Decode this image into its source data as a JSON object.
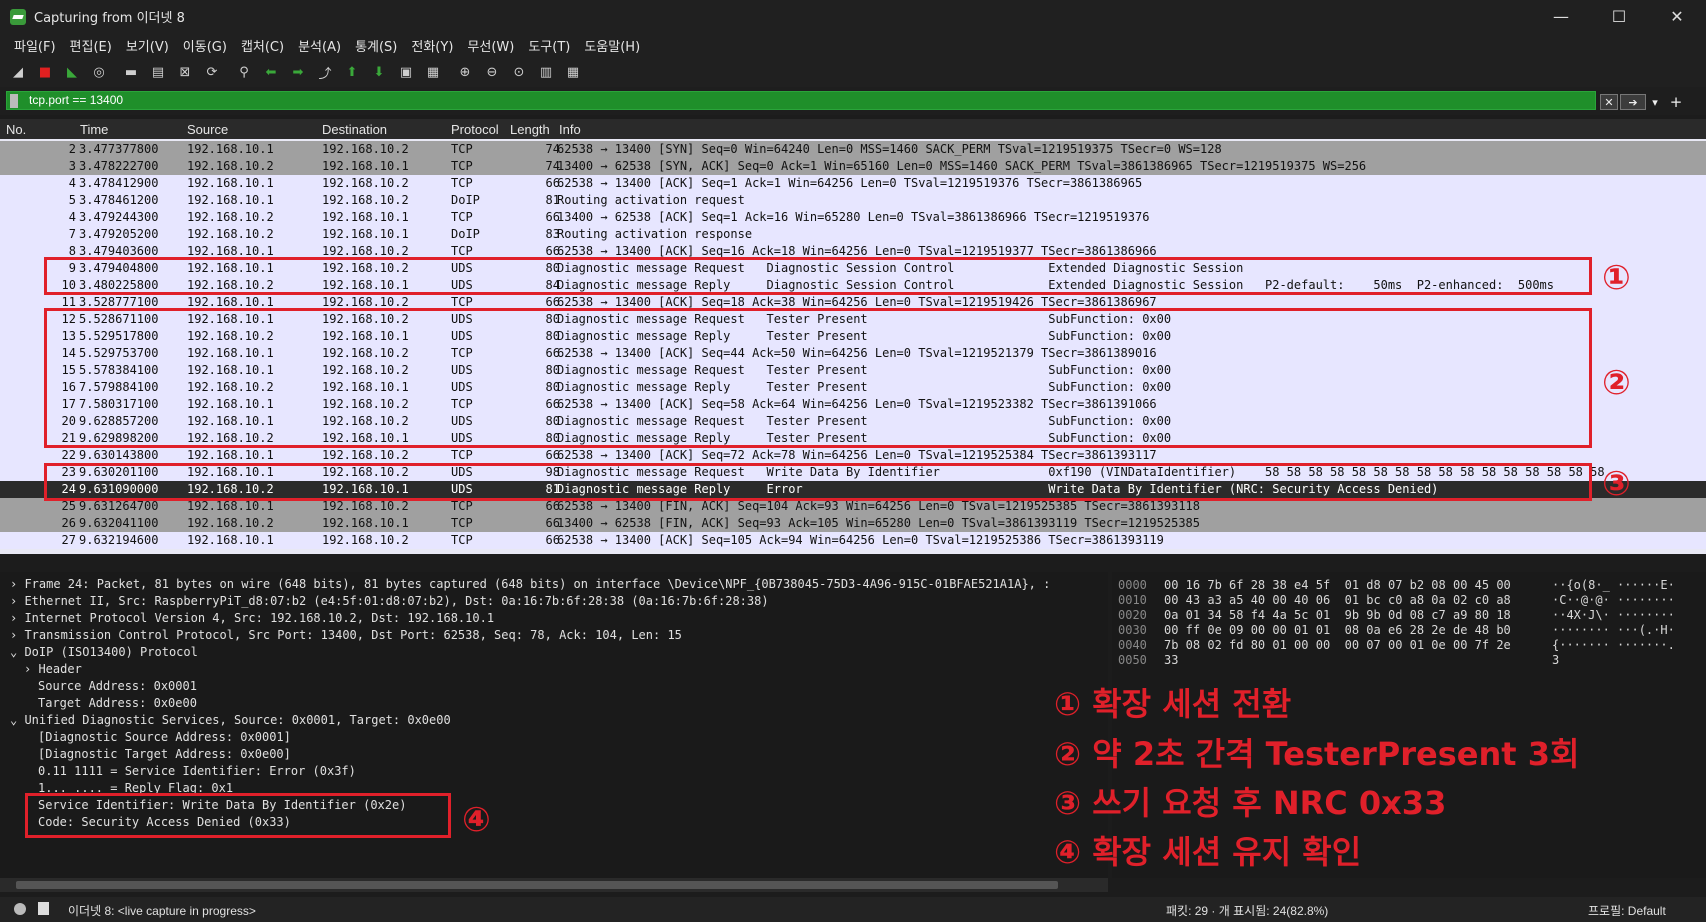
{
  "window": {
    "title": "Capturing from 이더넷 8",
    "controls": [
      "—",
      "☐",
      "✕"
    ]
  },
  "menu": [
    "파일(F)",
    "편집(E)",
    "보기(V)",
    "이동(G)",
    "캡처(C)",
    "분석(A)",
    "통계(S)",
    "전화(Y)",
    "무선(W)",
    "도구(T)",
    "도움말(H)"
  ],
  "toolbar": {
    "icons": [
      "shark-fin-icon",
      "stop-icon",
      "restart-icon",
      "options-icon",
      "open-icon",
      "save-icon",
      "close-file-icon",
      "reload-icon",
      "find-icon",
      "back-icon",
      "forward-icon",
      "goto-icon",
      "first-icon",
      "last-icon",
      "autoscroll-icon",
      "colorize-icon",
      "zoom-in-icon",
      "zoom-out-icon",
      "zoom-reset-icon",
      "resize-columns-icon",
      "layout-icon"
    ],
    "glyphs": [
      "◢",
      "■",
      "◣",
      "◎",
      "▬",
      "▤",
      "⊠",
      "⟳",
      "⚲",
      "⬅",
      "➡",
      "⤴",
      "⬆",
      "⬇",
      "▣",
      "▦",
      "⊕",
      "⊖",
      "⊙",
      "▥",
      "▦"
    ]
  },
  "filter": {
    "value": "tcp.port == 13400",
    "clear_label": "✕",
    "apply_label": "➔",
    "dropdown_label": "▾",
    "add_label": "+"
  },
  "columns": [
    "No.",
    "Time",
    "Source",
    "Destination",
    "Protocol",
    "Length",
    "Info"
  ],
  "packets": [
    {
      "no": "2",
      "time": "3.477377800",
      "src": "192.168.10.1",
      "dst": "192.168.10.2",
      "proto": "TCP",
      "len": "74",
      "info": "62538 → 13400 [SYN] Seq=0 Win=64240 Len=0 MSS=1460 SACK_PERM TSval=1219519375 TSecr=0 WS=128",
      "bg": "#a0a0a0"
    },
    {
      "no": "3",
      "time": "3.478222700",
      "src": "192.168.10.2",
      "dst": "192.168.10.1",
      "proto": "TCP",
      "len": "74",
      "info": "13400 → 62538 [SYN, ACK] Seq=0 Ack=1 Win=65160 Len=0 MSS=1460 SACK_PERM TSval=3861386965 TSecr=1219519375 WS=256",
      "bg": "#a0a0a0"
    },
    {
      "no": "4",
      "time": "3.478412900",
      "src": "192.168.10.1",
      "dst": "192.168.10.2",
      "proto": "TCP",
      "len": "66",
      "info": "62538 → 13400 [ACK] Seq=1 Ack=1 Win=64256 Len=0 TSval=1219519376 TSecr=3861386965",
      "bg": "#e7e6ff"
    },
    {
      "no": "5",
      "time": "3.478461200",
      "src": "192.168.10.1",
      "dst": "192.168.10.2",
      "proto": "DoIP",
      "len": "81",
      "info": "Routing activation request",
      "bg": "#e7e6ff"
    },
    {
      "no": "4",
      "time": "3.479244300",
      "src": "192.168.10.2",
      "dst": "192.168.10.1",
      "proto": "TCP",
      "len": "66",
      "info": "13400 → 62538 [ACK] Seq=1 Ack=16 Win=65280 Len=0 TSval=3861386966 TSecr=1219519376",
      "bg": "#e7e6ff"
    },
    {
      "no": "7",
      "time": "3.479205200",
      "src": "192.168.10.2",
      "dst": "192.168.10.1",
      "proto": "DoIP",
      "len": "83",
      "info": "Routing activation response",
      "bg": "#e7e6ff"
    },
    {
      "no": "8",
      "time": "3.479403600",
      "src": "192.168.10.1",
      "dst": "192.168.10.2",
      "proto": "TCP",
      "len": "66",
      "info": "62538 → 13400 [ACK] Seq=16 Ack=18 Win=64256 Len=0 TSval=1219519377 TSecr=3861386966",
      "bg": "#e7e6ff"
    },
    {
      "no": "9",
      "time": "3.479404800",
      "src": "192.168.10.1",
      "dst": "192.168.10.2",
      "proto": "UDS",
      "len": "80",
      "info": "Diagnostic message Request   Diagnostic Session Control             Extended Diagnostic Session",
      "bg": "#e7e6ff"
    },
    {
      "no": "10",
      "time": "3.480225800",
      "src": "192.168.10.2",
      "dst": "192.168.10.1",
      "proto": "UDS",
      "len": "84",
      "info": "Diagnostic message Reply     Diagnostic Session Control             Extended Diagnostic Session   P2-default:    50ms  P2-enhanced:  500ms",
      "bg": "#e7e6ff"
    },
    {
      "no": "11",
      "time": "3.528777100",
      "src": "192.168.10.1",
      "dst": "192.168.10.2",
      "proto": "TCP",
      "len": "66",
      "info": "62538 → 13400 [ACK] Seq=18 Ack=38 Win=64256 Len=0 TSval=1219519426 TSecr=3861386967",
      "bg": "#e7e6ff"
    },
    {
      "no": "12",
      "time": "5.528671100",
      "src": "192.168.10.1",
      "dst": "192.168.10.2",
      "proto": "UDS",
      "len": "80",
      "info": "Diagnostic message Request   Tester Present                         SubFunction: 0x00",
      "bg": "#e7e6ff"
    },
    {
      "no": "13",
      "time": "5.529517800",
      "src": "192.168.10.2",
      "dst": "192.168.10.1",
      "proto": "UDS",
      "len": "80",
      "info": "Diagnostic message Reply     Tester Present                         SubFunction: 0x00",
      "bg": "#e7e6ff"
    },
    {
      "no": "14",
      "time": "5.529753700",
      "src": "192.168.10.1",
      "dst": "192.168.10.2",
      "proto": "TCP",
      "len": "66",
      "info": "62538 → 13400 [ACK] Seq=44 Ack=50 Win=64256 Len=0 TSval=1219521379 TSecr=3861389016",
      "bg": "#e7e6ff"
    },
    {
      "no": "15",
      "time": "5.578384100",
      "src": "192.168.10.1",
      "dst": "192.168.10.2",
      "proto": "UDS",
      "len": "80",
      "info": "Diagnostic message Request   Tester Present                         SubFunction: 0x00",
      "bg": "#e7e6ff"
    },
    {
      "no": "16",
      "time": "7.579884100",
      "src": "192.168.10.2",
      "dst": "192.168.10.1",
      "proto": "UDS",
      "len": "80",
      "info": "Diagnostic message Reply     Tester Present                         SubFunction: 0x00",
      "bg": "#e7e6ff"
    },
    {
      "no": "17",
      "time": "7.580317100",
      "src": "192.168.10.1",
      "dst": "192.168.10.2",
      "proto": "TCP",
      "len": "66",
      "info": "62538 → 13400 [ACK] Seq=58 Ack=64 Win=64256 Len=0 TSval=1219523382 TSecr=3861391066",
      "bg": "#e7e6ff"
    },
    {
      "no": "20",
      "time": "9.628857200",
      "src": "192.168.10.1",
      "dst": "192.168.10.2",
      "proto": "UDS",
      "len": "80",
      "info": "Diagnostic message Request   Tester Present                         SubFunction: 0x00",
      "bg": "#e7e6ff"
    },
    {
      "no": "21",
      "time": "9.629898200",
      "src": "192.168.10.2",
      "dst": "192.168.10.1",
      "proto": "UDS",
      "len": "80",
      "info": "Diagnostic message Reply     Tester Present                         SubFunction: 0x00",
      "bg": "#e7e6ff"
    },
    {
      "no": "22",
      "time": "9.630143800",
      "src": "192.168.10.1",
      "dst": "192.168.10.2",
      "proto": "TCP",
      "len": "66",
      "info": "62538 → 13400 [ACK] Seq=72 Ack=78 Win=64256 Len=0 TSval=1219525384 TSecr=3861393117",
      "bg": "#e7e6ff"
    },
    {
      "no": "23",
      "time": "9.630201100",
      "src": "192.168.10.1",
      "dst": "192.168.10.2",
      "proto": "UDS",
      "len": "98",
      "info": "Diagnostic message Request   Write Data By Identifier               0xf190 (VINDataIdentifier)    58 58 58 58 58 58 58 58 58 58 58 58 58 58 58 58",
      "bg": "#e7e6ff"
    },
    {
      "no": "24",
      "time": "9.631090000",
      "src": "192.168.10.2",
      "dst": "192.168.10.1",
      "proto": "UDS",
      "len": "81",
      "info": "Diagnostic message Reply     Error                                  Write Data By Identifier (NRC: Security Access Denied)",
      "bg": "selected"
    },
    {
      "no": "25",
      "time": "9.631264700",
      "src": "192.168.10.1",
      "dst": "192.168.10.2",
      "proto": "TCP",
      "len": "66",
      "info": "62538 → 13400 [FIN, ACK] Seq=104 Ack=93 Win=64256 Len=0 TSval=1219525385 TSecr=3861393118",
      "bg": "#a0a0a0"
    },
    {
      "no": "26",
      "time": "9.632041100",
      "src": "192.168.10.2",
      "dst": "192.168.10.1",
      "proto": "TCP",
      "len": "66",
      "info": "13400 → 62538 [FIN, ACK] Seq=93 Ack=105 Win=65280 Len=0 TSval=3861393119 TSecr=1219525385",
      "bg": "#a0a0a0"
    },
    {
      "no": "27",
      "time": "9.632194600",
      "src": "192.168.10.1",
      "dst": "192.168.10.2",
      "proto": "TCP",
      "len": "66",
      "info": "62538 → 13400 [ACK] Seq=105 Ack=94 Win=64256 Len=0 TSval=1219525386 TSecr=3861393119",
      "bg": "#e7e6ff"
    }
  ],
  "details": [
    {
      "text": "› Frame 24: Packet, 81 bytes on wire (648 bits), 81 bytes captured (648 bits) on interface \\Device\\NPF_{0B738045-75D3-4A96-915C-01BFAE521A1A}, :",
      "indent": 0
    },
    {
      "text": "› Ethernet II, Src: RaspberryPiT_d8:07:b2 (e4:5f:01:d8:07:b2), Dst: 0a:16:7b:6f:28:38 (0a:16:7b:6f:28:38)",
      "indent": 0
    },
    {
      "text": "› Internet Protocol Version 4, Src: 192.168.10.2, Dst: 192.168.10.1",
      "indent": 0
    },
    {
      "text": "› Transmission Control Protocol, Src Port: 13400, Dst Port: 62538, Seq: 78, Ack: 104, Len: 15",
      "indent": 0
    },
    {
      "text": "⌄ DoIP (ISO13400) Protocol",
      "indent": 0
    },
    {
      "text": "› Header",
      "indent": 1
    },
    {
      "text": "Source Address: 0x0001",
      "indent": 2
    },
    {
      "text": "Target Address: 0x0e00",
      "indent": 2
    },
    {
      "text": "⌄ Unified Diagnostic Services, Source: 0x0001, Target: 0x0e00",
      "indent": 0
    },
    {
      "text": "[Diagnostic Source Address: 0x0001]",
      "indent": 2
    },
    {
      "text": "[Diagnostic Target Address: 0x0e00]",
      "indent": 2
    },
    {
      "text": "0.11 1111 = Service Identifier: Error (0x3f)",
      "indent": 2
    },
    {
      "text": "1... .... = Reply Flag: 0x1",
      "indent": 2
    },
    {
      "text": "Service Identifier: Write Data By Identifier (0x2e)",
      "indent": 2
    },
    {
      "text": "Code: Security Access Denied (0x33)",
      "indent": 2
    }
  ],
  "hex": [
    {
      "off": "0000",
      "bytes": "00 16 7b 6f 28 38 e4 5f  01 d8 07 b2 08 00 45 00",
      "ascii": "··{o(8·_ ······E·"
    },
    {
      "off": "0010",
      "bytes": "00 43 a3 a5 40 00 40 06  01 bc c0 a8 0a 02 c0 a8",
      "ascii": "·C··@·@· ········"
    },
    {
      "off": "0020",
      "bytes": "0a 01 34 58 f4 4a 5c 01  9b 9b 0d 08 c7 a9 80 18",
      "ascii": "··4X·J\\· ········"
    },
    {
      "off": "0030",
      "bytes": "00 ff 0e 09 00 00 01 01  08 0a e6 28 2e de 48 b0",
      "ascii": "········ ···(.·H·"
    },
    {
      "off": "0040",
      "bytes": "7b 08 02 fd 80 01 00 00  00 07 00 01 0e 00 7f 2e",
      "ascii": "{······· ·······."
    },
    {
      "off": "0050",
      "bytes": "33",
      "ascii": "3"
    }
  ],
  "annotations": {
    "markers": [
      "①",
      "②",
      "③",
      "④"
    ],
    "legend": [
      "① 확장 세션 전환",
      "② 약 2초 간격 TesterPresent  3회",
      "③ 쓰기 요청 후 NRC 0x33",
      "④ 확장 세션 유지 확인"
    ],
    "color": "#e0202a"
  },
  "status": {
    "left": "이더넷 8: <live capture in progress>",
    "packets": "패킷: 29 · 개 표시됨: 24(82.8%)",
    "profile": "프로필: Default"
  }
}
